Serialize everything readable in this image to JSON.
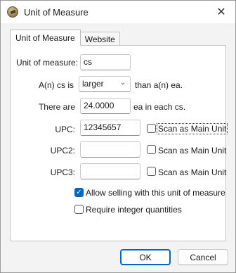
{
  "window": {
    "title": "Unit of Measure",
    "close_glyph": "✕",
    "app_icon": "tag-icon"
  },
  "tabs": [
    {
      "label": "Unit of Measure",
      "active": true
    },
    {
      "label": "Website",
      "active": false
    }
  ],
  "form": {
    "uom_label": "Unit of measure:",
    "uom_value": "cs",
    "relation_prefix": "A(n) cs is",
    "relation_select": "larger",
    "relation_suffix": "than a(n) ea.",
    "there_are_label": "There are",
    "quantity_value": "24.0000",
    "quantity_suffix": "ea in each cs.",
    "upc_label": "UPC:",
    "upc_value": "12345657",
    "upc2_label": "UPC2:",
    "upc2_value": "",
    "upc3_label": "UPC3:",
    "upc3_value": "",
    "scan_main_label": "Scan as Main Unit",
    "scan_main_upc_checked": false,
    "scan_main_upc2_checked": false,
    "scan_main_upc3_checked": false,
    "allow_selling_label": "Allow selling with this unit of measure",
    "allow_selling_checked": true,
    "require_integer_label": "Require integer quantities",
    "require_integer_checked": false
  },
  "buttons": {
    "ok_label": "OK",
    "cancel_label": "Cancel"
  },
  "colors": {
    "accent": "#0067c0"
  }
}
